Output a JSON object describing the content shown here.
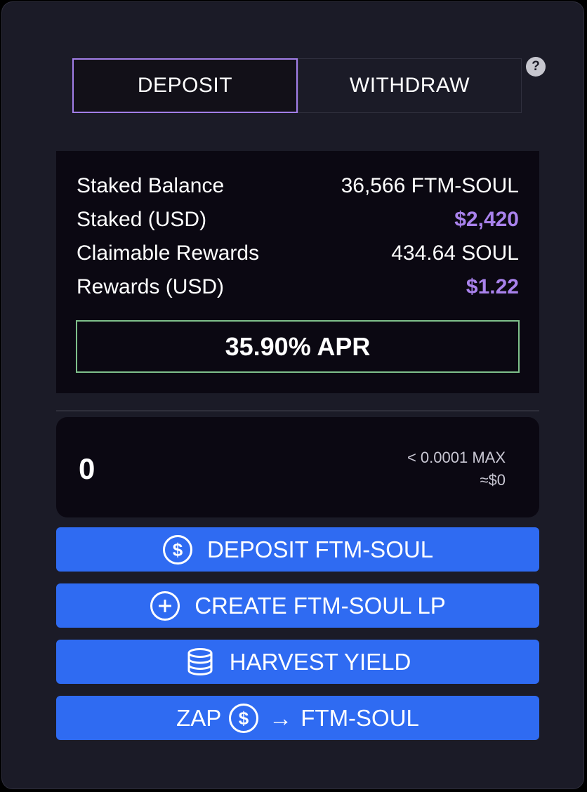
{
  "tabs": {
    "deposit": "DEPOSIT",
    "withdraw": "WITHDRAW",
    "help": "?"
  },
  "stats": {
    "staked_balance": {
      "label": "Staked Balance",
      "value": "36,566 FTM-SOUL"
    },
    "staked_usd": {
      "label": "Staked (USD)",
      "value": "$2,420"
    },
    "claimable_rewards": {
      "label": "Claimable Rewards",
      "value": "434.64 SOUL"
    },
    "rewards_usd": {
      "label": "Rewards (USD)",
      "value": "$1.22"
    },
    "apr": "35.90% APR"
  },
  "amount": {
    "value": "0",
    "balance": "< 0.0001",
    "max_label": "MAX",
    "usd_value": "≈$0"
  },
  "buttons": {
    "deposit": "DEPOSIT FTM-SOUL",
    "create_lp": "CREATE FTM-SOUL LP",
    "harvest": "HARVEST YIELD",
    "zap_prefix": "ZAP",
    "zap_arrow": "→",
    "zap_target": "FTM-SOUL"
  },
  "icons": {
    "deposit": "dollar-circle-icon",
    "create_lp": "plus-circle-icon",
    "harvest": "coin-stack-icon",
    "zap": "dollar-circle-icon"
  },
  "colors": {
    "accent_purple": "#a982ec",
    "button_blue": "#2f6bf2",
    "apr_border_green": "#7fc08b",
    "panel_bg": "#1b1b27",
    "inner_bg": "#0b0812"
  }
}
